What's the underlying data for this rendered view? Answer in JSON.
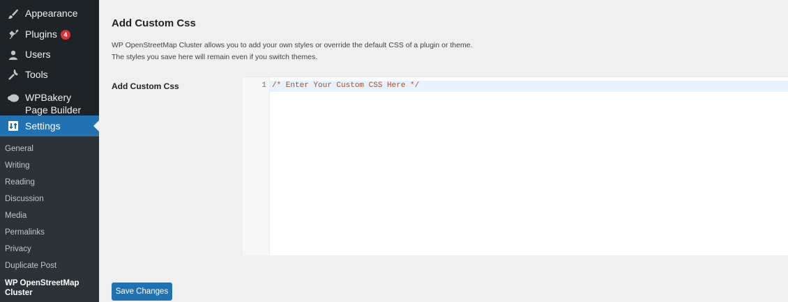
{
  "sidebar": {
    "items": [
      {
        "label": "Appearance",
        "icon": "paintbrush-icon"
      },
      {
        "label": "Plugins",
        "icon": "plug-icon",
        "badge": "4"
      },
      {
        "label": "Users",
        "icon": "users-icon"
      },
      {
        "label": "Tools",
        "icon": "wrench-icon"
      },
      {
        "label": "WPBakery Page Builder",
        "icon": "wpbakery-icon"
      }
    ],
    "settings": {
      "label": "Settings",
      "icon": "settings-icon"
    },
    "submenu": [
      {
        "label": "General"
      },
      {
        "label": "Writing"
      },
      {
        "label": "Reading"
      },
      {
        "label": "Discussion"
      },
      {
        "label": "Media"
      },
      {
        "label": "Permalinks"
      },
      {
        "label": "Privacy"
      },
      {
        "label": "Duplicate Post"
      },
      {
        "label": "WP OpenStreetMap Cluster"
      }
    ]
  },
  "main": {
    "title": "Add Custom Css",
    "description_line1": "WP OpenStreetMap Cluster allows you to add your own styles or override the default CSS of a plugin or theme.",
    "description_line2": "The styles you save here will remain even if you switch themes.",
    "field_label": "Add Custom Css",
    "editor": {
      "line_number": "1",
      "code": "/* Enter Your Custom CSS Here */"
    },
    "save_label": "Save Changes"
  },
  "colors": {
    "sidebar_bg": "#1d2327",
    "submenu_bg": "#2c3338",
    "accent": "#2271b1",
    "badge": "#d63638"
  }
}
